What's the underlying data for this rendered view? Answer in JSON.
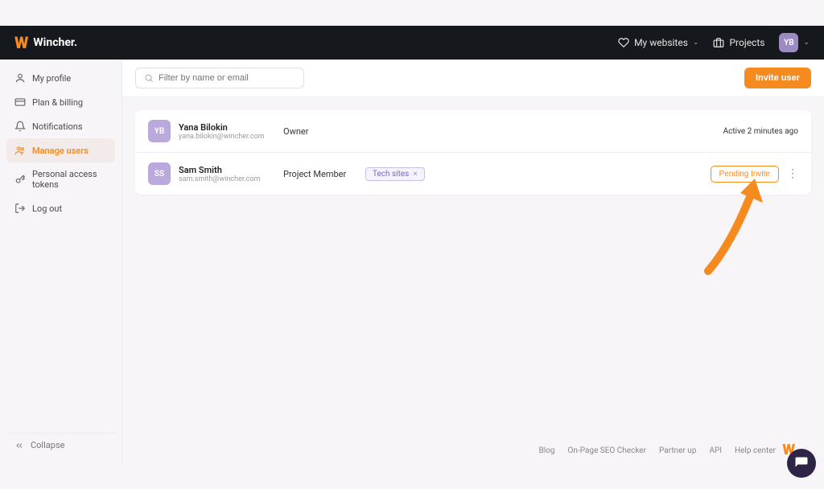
{
  "brand": {
    "name": "Wincher."
  },
  "topnav": {
    "my_websites": "My websites",
    "projects": "Projects",
    "user_initials": "YB"
  },
  "sidebar": {
    "items": [
      {
        "label": "My profile"
      },
      {
        "label": "Plan & billing"
      },
      {
        "label": "Notifications"
      },
      {
        "label": "Manage users"
      },
      {
        "label": "Personal access tokens"
      },
      {
        "label": "Log out"
      }
    ],
    "collapse": "Collapse"
  },
  "main": {
    "search_placeholder": "Filter by name or email",
    "invite_button": "Invite user"
  },
  "users": [
    {
      "initials": "YB",
      "name": "Yana Bilokin",
      "email": "yana.bilokin@wincher.com",
      "role": "Owner",
      "status": "Active 2 minutes ago"
    },
    {
      "initials": "SS",
      "name": "Sam Smith",
      "email": "sam.smith@wincher.com",
      "role": "Project Member",
      "tag": "Tech sites",
      "pending": "Pending Invite"
    }
  ],
  "footer": {
    "links": [
      "Blog",
      "On-Page SEO Checker",
      "Partner up",
      "API",
      "Help center"
    ]
  },
  "colors": {
    "accent": "#f58a1f",
    "purple": "#9b8bc2"
  }
}
